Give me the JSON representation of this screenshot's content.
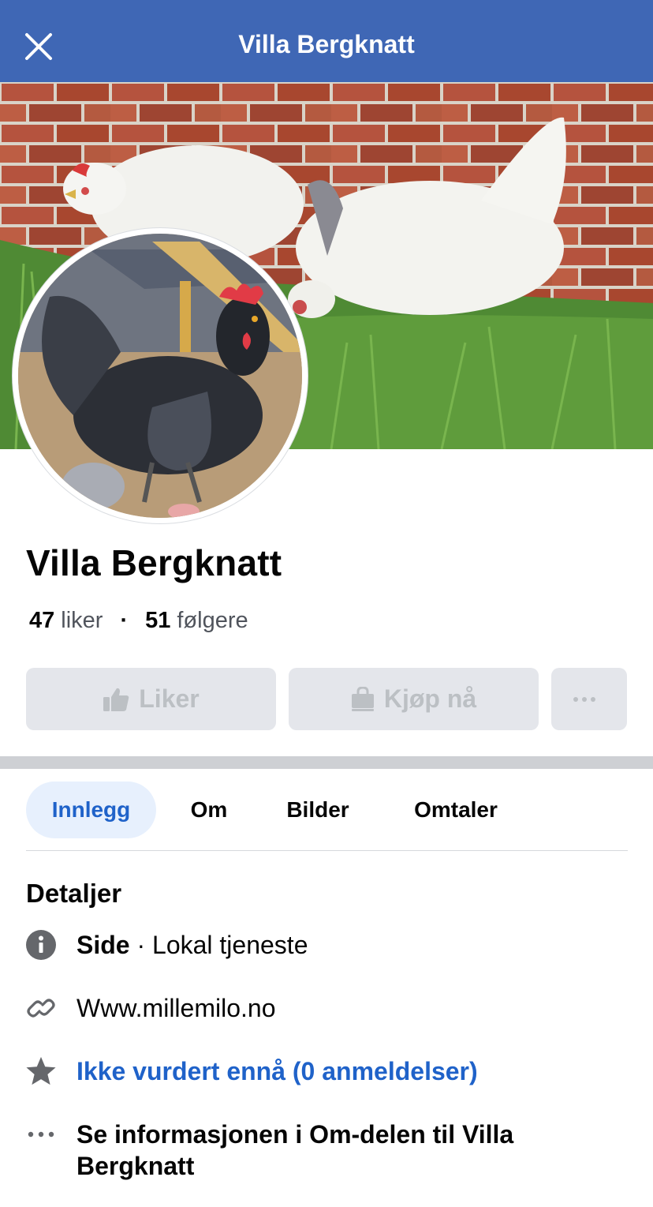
{
  "header": {
    "title": "Villa Bergknatt",
    "close_icon": "close-icon",
    "background_color": "#3f67b5"
  },
  "cover": {
    "description_icon": "cover-photo"
  },
  "profile": {
    "name": "Villa Bergknatt",
    "likes_count": "47",
    "likes_label": "liker",
    "separator": "·",
    "followers_count": "51",
    "followers_label": "følgere"
  },
  "actions": {
    "like_label": "Liker",
    "like_icon": "thumbs-up-icon",
    "shop_label": "Kjøp nå",
    "shop_icon": "shopping-bag-icon",
    "more_icon": "more-dots-icon",
    "more_label": "···"
  },
  "tabs": [
    {
      "label": "Innlegg",
      "active": true
    },
    {
      "label": "Om",
      "active": false
    },
    {
      "label": "Bilder",
      "active": false
    },
    {
      "label": "Omtaler",
      "active": false
    }
  ],
  "details": {
    "title": "Detaljer",
    "category_type": "Side",
    "category_sep": " · ",
    "category_value": "Lokal tjeneste",
    "website": "Www.millemilo.no",
    "rating": "Ikke vurdert ennå (0 anmeldelser)",
    "about_more": "Se informasjonen i Om-delen til Villa Bergknatt",
    "icons": [
      "info-icon",
      "link-icon",
      "star-icon",
      "more-dots-icon"
    ]
  },
  "colors": {
    "accent_blue": "#1f62c9",
    "button_bg": "#e4e6eb",
    "button_disabled_text": "#bcc0c4",
    "tab_active_bg": "#e7f0fd"
  }
}
